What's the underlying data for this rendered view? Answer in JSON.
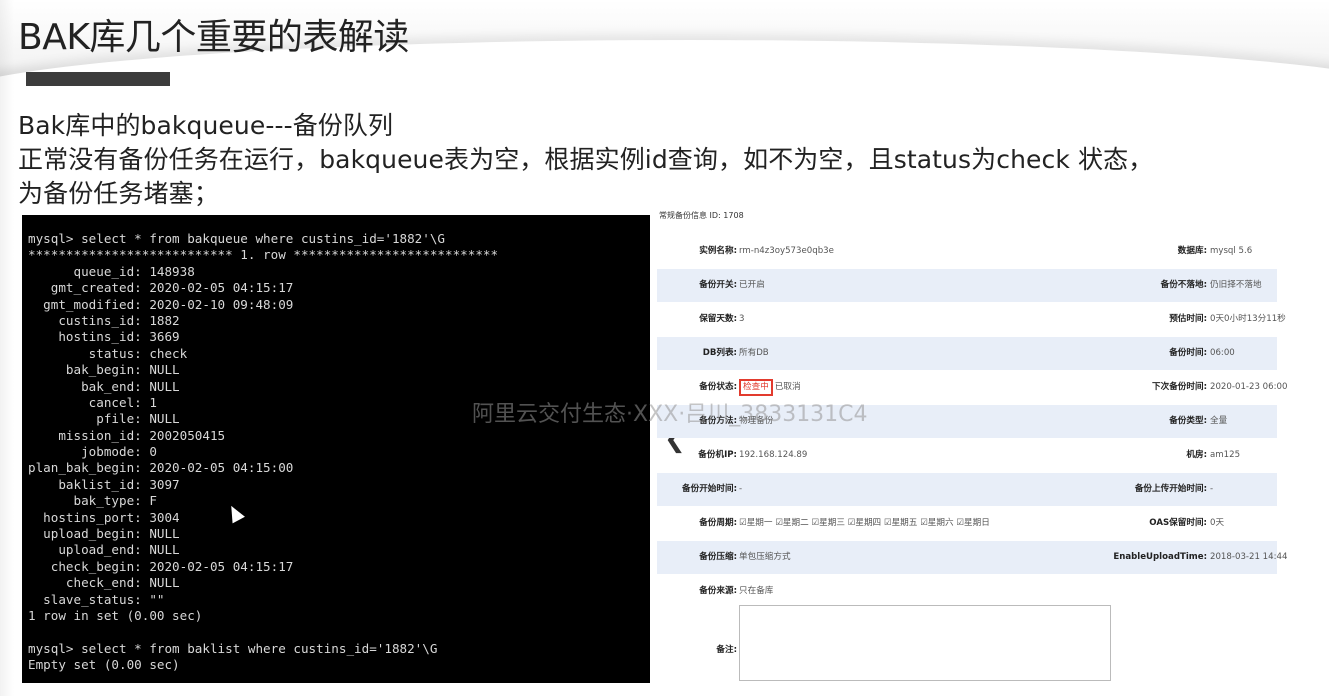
{
  "slide": {
    "title": "BAK库几个重要的表解读",
    "desc_lines": [
      "Bak库中的bakqueue---备份队列",
      "正常没有备份任务在运行，bakqueue表为空，根据实例id查询，如不为空，且status为check 状态，",
      "为备份任务堵塞；"
    ]
  },
  "terminal": {
    "lines": [
      "mysql> select * from bakqueue where custins_id='1882'\\G",
      "*************************** 1. row ***************************",
      "      queue_id: 148938",
      "   gmt_created: 2020-02-05 04:15:17",
      "  gmt_modified: 2020-02-10 09:48:09",
      "    custins_id: 1882",
      "    hostins_id: 3669",
      "        status: check",
      "     bak_begin: NULL",
      "       bak_end: NULL",
      "        cancel: 1",
      "         pfile: NULL",
      "    mission_id: 2002050415",
      "       jobmode: 0",
      "plan_bak_begin: 2020-02-05 04:15:00",
      "    baklist_id: 3097",
      "      bak_type: F",
      "  hostins_port: 3004",
      "  upload_begin: NULL",
      "    upload_end: NULL",
      "   check_begin: 2020-02-05 04:15:17",
      "     check_end: NULL",
      "  slave_status: \"\"",
      "1 row in set (0.00 sec)",
      "",
      "mysql> select * from baklist where custins_id='1882'\\G",
      "Empty set (0.00 sec)"
    ]
  },
  "panel": {
    "header": "常规备份信息 ID: 1708",
    "rows": [
      {
        "l1": "实例名称:",
        "v1": "rm-n4z3oy573e0qb3e",
        "l2": "数据库:",
        "v2": "mysql 5.6"
      },
      {
        "l1": "备份开关:",
        "v1": "已开启",
        "l2": "备份不落地:",
        "v2": "仍旧择不落地"
      },
      {
        "l1": "保留天数:",
        "v1": "3",
        "l2": "预估时间:",
        "v2": "0天0小时13分11秒"
      },
      {
        "l1": "DB列表:",
        "v1": "所有DB",
        "l2": "备份时间:",
        "v2": "06:00"
      },
      {
        "l1": "备份状态:",
        "status_tag": "检查中",
        "v1": "已取消",
        "l2": "下次备份时间:",
        "v2": "2020-01-23 06:00"
      },
      {
        "l1": "备份方法:",
        "v1": "物理备份",
        "l2": "备份类型:",
        "v2": "全量"
      },
      {
        "l1": "备份机IP:",
        "v1": "192.168.124.89",
        "l2": "机房:",
        "v2": "am125"
      },
      {
        "l1": "备份开始时间:",
        "v1": "-",
        "l2": "备份上传开始时间:",
        "v2": "-"
      },
      {
        "l1": "备份周期:",
        "v1": "☑星期一 ☑星期二 ☑星期三 ☑星期四 ☑星期五 ☑星期六 ☑星期日",
        "l2": "OAS保留时间:",
        "v2": "0天"
      },
      {
        "l1": "备份压缩:",
        "v1": "单包压缩方式",
        "l2": "EnableUploadTime:",
        "v2": "2018-03-21 14:44"
      },
      {
        "l1": "备份来源:",
        "v1": "只在备库",
        "l2": "",
        "v2": ""
      }
    ],
    "remark_label": "备注:"
  },
  "watermark": "阿里云交付生态·XXX·吕川_3833131C4"
}
